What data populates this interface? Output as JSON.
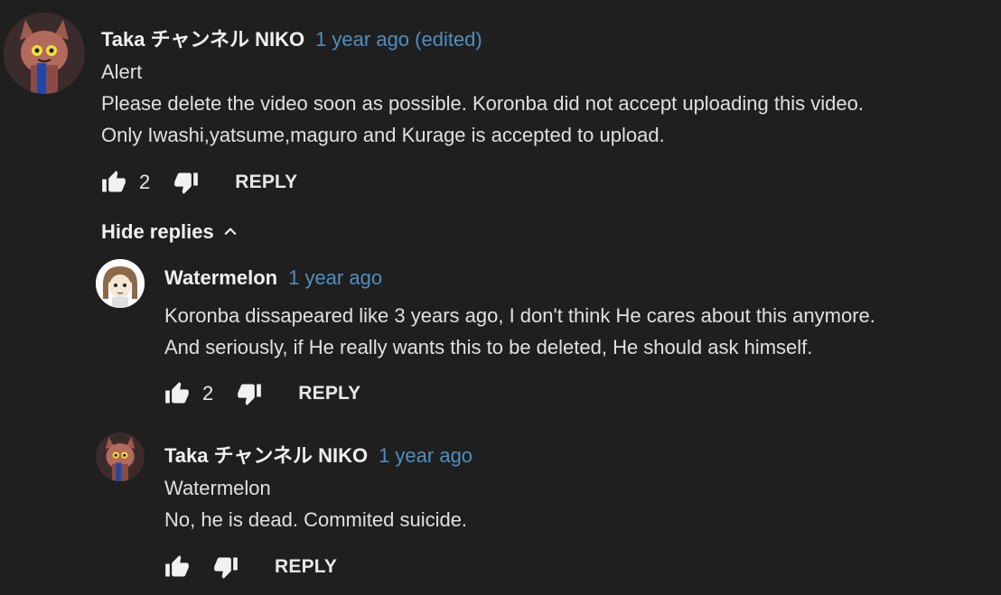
{
  "comments": [
    {
      "author": "Taka チャンネル NIKO",
      "time": "1 year ago (edited)",
      "lines": [
        "Alert",
        "Please delete the video soon as possible. Koronba did not accept uploading this video.",
        "Only Iwashi,yatsume,maguro and Kurage is accepted to upload."
      ],
      "likes": "2",
      "reply_label": "REPLY"
    }
  ],
  "hide_replies_label": "Hide replies",
  "replies": [
    {
      "author": "Watermelon",
      "time": "1 year ago",
      "lines": [
        "Koronba dissapeared like 3 years ago, I don't think He cares about this anymore.",
        "And seriously, if He really wants this to be deleted, He should ask himself."
      ],
      "likes": "2",
      "reply_label": "REPLY"
    },
    {
      "author": "Taka チャンネル NIKO",
      "time": "1 year ago",
      "lines": [
        "Watermelon",
        "No, he is dead. Commited suicide."
      ],
      "likes": "",
      "reply_label": "REPLY"
    }
  ],
  "icons": {
    "like": "thumb-up-icon",
    "dislike": "thumb-down-icon",
    "chevron": "chevron-up-icon"
  }
}
